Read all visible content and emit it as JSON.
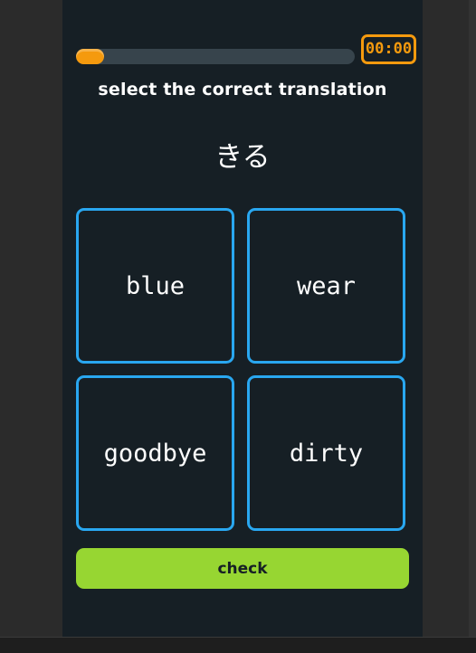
{
  "progress": {
    "fraction": 0.1
  },
  "timer": {
    "display": "00:00"
  },
  "question": {
    "instruction": "select the correct translation",
    "word": "きる"
  },
  "options": [
    {
      "label": "blue"
    },
    {
      "label": "wear"
    },
    {
      "label": "goodbye"
    },
    {
      "label": "dirty"
    }
  ],
  "check_button": {
    "label": "check"
  },
  "colors": {
    "background": "#161f25",
    "progress_track": "#37444c",
    "accent_orange": "#f59a0e",
    "option_border": "#29a7f0",
    "check_green": "#97d632"
  }
}
